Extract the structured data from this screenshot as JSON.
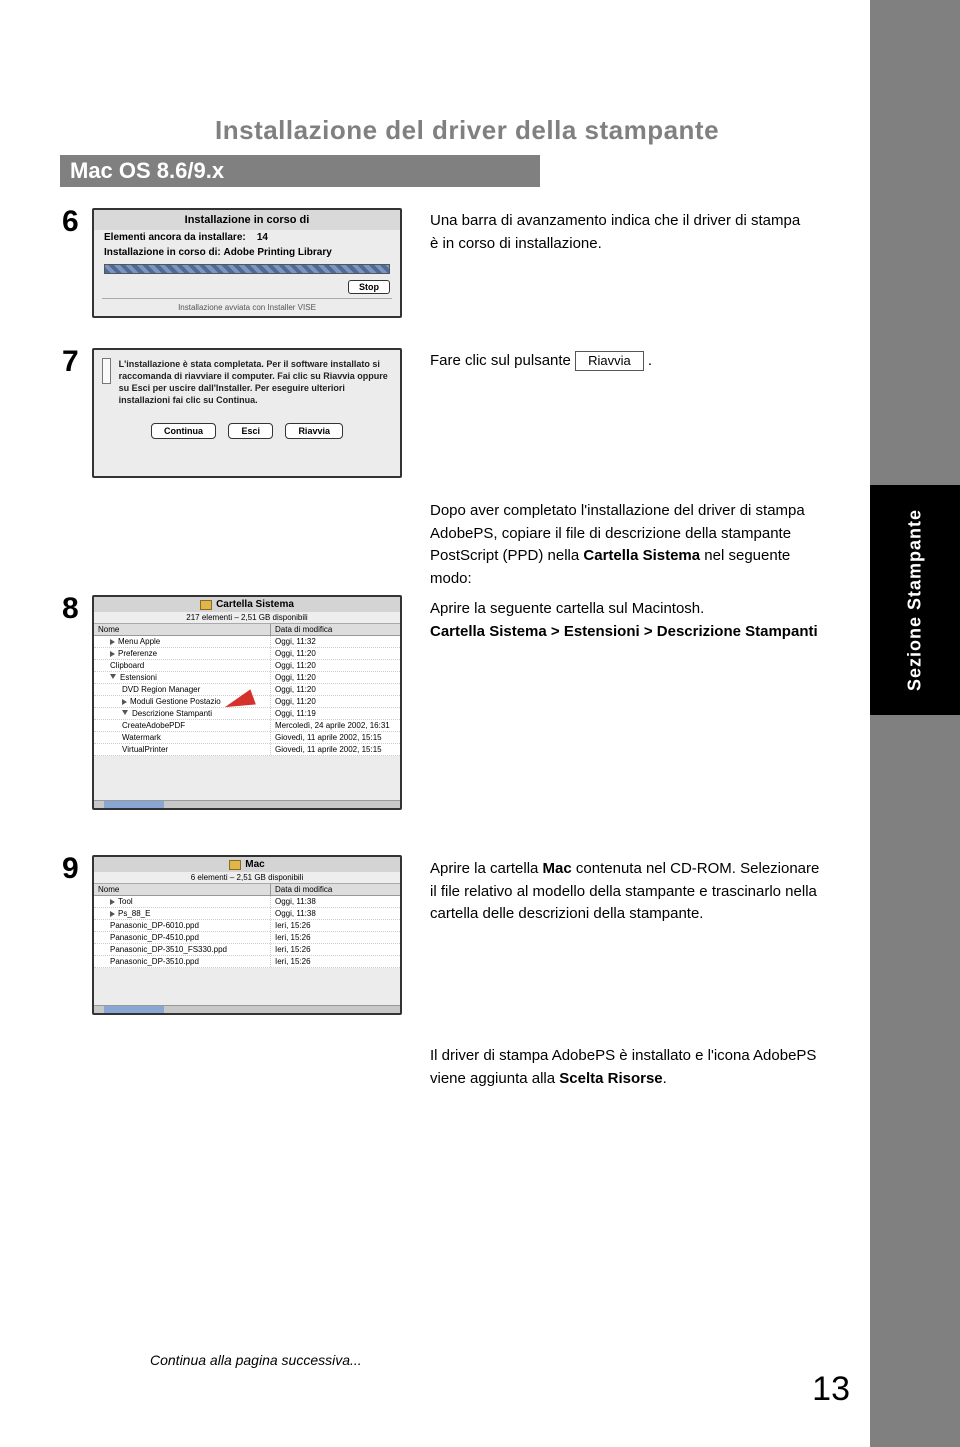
{
  "page_title": "Installazione del driver della stampante",
  "section_header": "Mac OS 8.6/9.x",
  "side_tab": "Sezione Stampante",
  "steps": {
    "6": {
      "num": "6",
      "text": "Una barra di avanzamento indica che il driver di stampa è in corso di installazione."
    },
    "7": {
      "num": "7",
      "prefix": "Fare clic sul pulsante ",
      "button": "Riavvia",
      "suffix": " ."
    },
    "8pre": "Dopo aver completato l'installazione del driver di stampa AdobePS, copiare il file di descrizione della stampante PostScript (PPD) nella Cartella Sistema nel seguente modo:",
    "8": {
      "num": "8",
      "line1": "Aprire la seguente cartella sul Macintosh.",
      "line2": "Cartella Sistema > Estensioni > Descrizione Stampanti"
    },
    "9": {
      "num": "9",
      "t1": "Aprire la cartella ",
      "t1b": "Mac",
      "t1c": " contenuta nel CD-ROM. Selezionare il file relativo al modello della stampante e trascinarlo nella cartella delle descrizioni della stampante."
    },
    "final": "Il driver di stampa AdobePS è installato e l'icona AdobePS viene aggiunta alla Scelta Risorse."
  },
  "shot6": {
    "title": "Installazione in corso di",
    "l1a": "Elementi ancora da installare:",
    "l1b": "14",
    "l2a": "Installazione in corso di:",
    "l2b": "Adobe Printing Library",
    "stop": "Stop",
    "foot": "Installazione avviata con Installer VISE"
  },
  "shot7": {
    "msg": "L'installazione è stata completata. Per il software installato si raccomanda di riavviare il computer. Fai clic su Riavvia oppure su Esci per uscire dall'Installer. Per eseguire ulteriori installazioni fai clic su Continua.",
    "b1": "Continua",
    "b2": "Esci",
    "b3": "Riavvia"
  },
  "shot8": {
    "title": "Cartella Sistema",
    "sub": "217 elementi – 2,51 GB disponibili",
    "hdr_name": "Nome",
    "hdr_date": "Data di modifica",
    "rows": [
      {
        "n": "Menu Apple",
        "d": "Oggi, 11:32",
        "tri": "closed"
      },
      {
        "n": "Preferenze",
        "d": "Oggi, 11:20",
        "tri": "closed"
      },
      {
        "n": "Clipboard",
        "d": "Oggi, 11:20",
        "tri": "none"
      },
      {
        "n": "Estensioni",
        "d": "Oggi, 11:20",
        "tri": "open"
      },
      {
        "n": "DVD Region Manager",
        "d": "Oggi, 11:20",
        "tri": "none",
        "indent": true
      },
      {
        "n": "Moduli Gestione Postazio",
        "d": "Oggi, 11:20",
        "tri": "closed",
        "indent": true
      },
      {
        "n": "Descrizione Stampanti",
        "d": "Oggi, 11:19",
        "tri": "open",
        "indent": true
      },
      {
        "n": "CreateAdobePDF",
        "d": "Mercoledì, 24 aprile 2002, 16:31",
        "tri": "none",
        "indent": true
      },
      {
        "n": "Watermark",
        "d": "Giovedì, 11 aprile 2002, 15:15",
        "tri": "none",
        "indent": true
      },
      {
        "n": "VirtualPrinter",
        "d": "Giovedì, 11 aprile 2002, 15:15",
        "tri": "none",
        "indent": true
      }
    ]
  },
  "shot9": {
    "title": "Mac",
    "sub": "6 elementi – 2,51 GB disponibili",
    "hdr_name": "Nome",
    "hdr_date": "Data di modifica",
    "rows": [
      {
        "n": "Tool",
        "d": "Oggi, 11:38",
        "tri": "closed"
      },
      {
        "n": "Ps_88_E",
        "d": "Oggi, 11:38",
        "tri": "closed"
      },
      {
        "n": "Panasonic_DP-6010.ppd",
        "d": "Ieri, 15:26",
        "tri": "none"
      },
      {
        "n": "Panasonic_DP-4510.ppd",
        "d": "Ieri, 15:26",
        "tri": "none"
      },
      {
        "n": "Panasonic_DP-3510_FS330.ppd",
        "d": "Ieri, 15:26",
        "tri": "none"
      },
      {
        "n": "Panasonic_DP-3510.ppd",
        "d": "Ieri, 15:26",
        "tri": "none"
      }
    ]
  },
  "continue": "Continua alla pagina successiva...",
  "pagenum": "13"
}
